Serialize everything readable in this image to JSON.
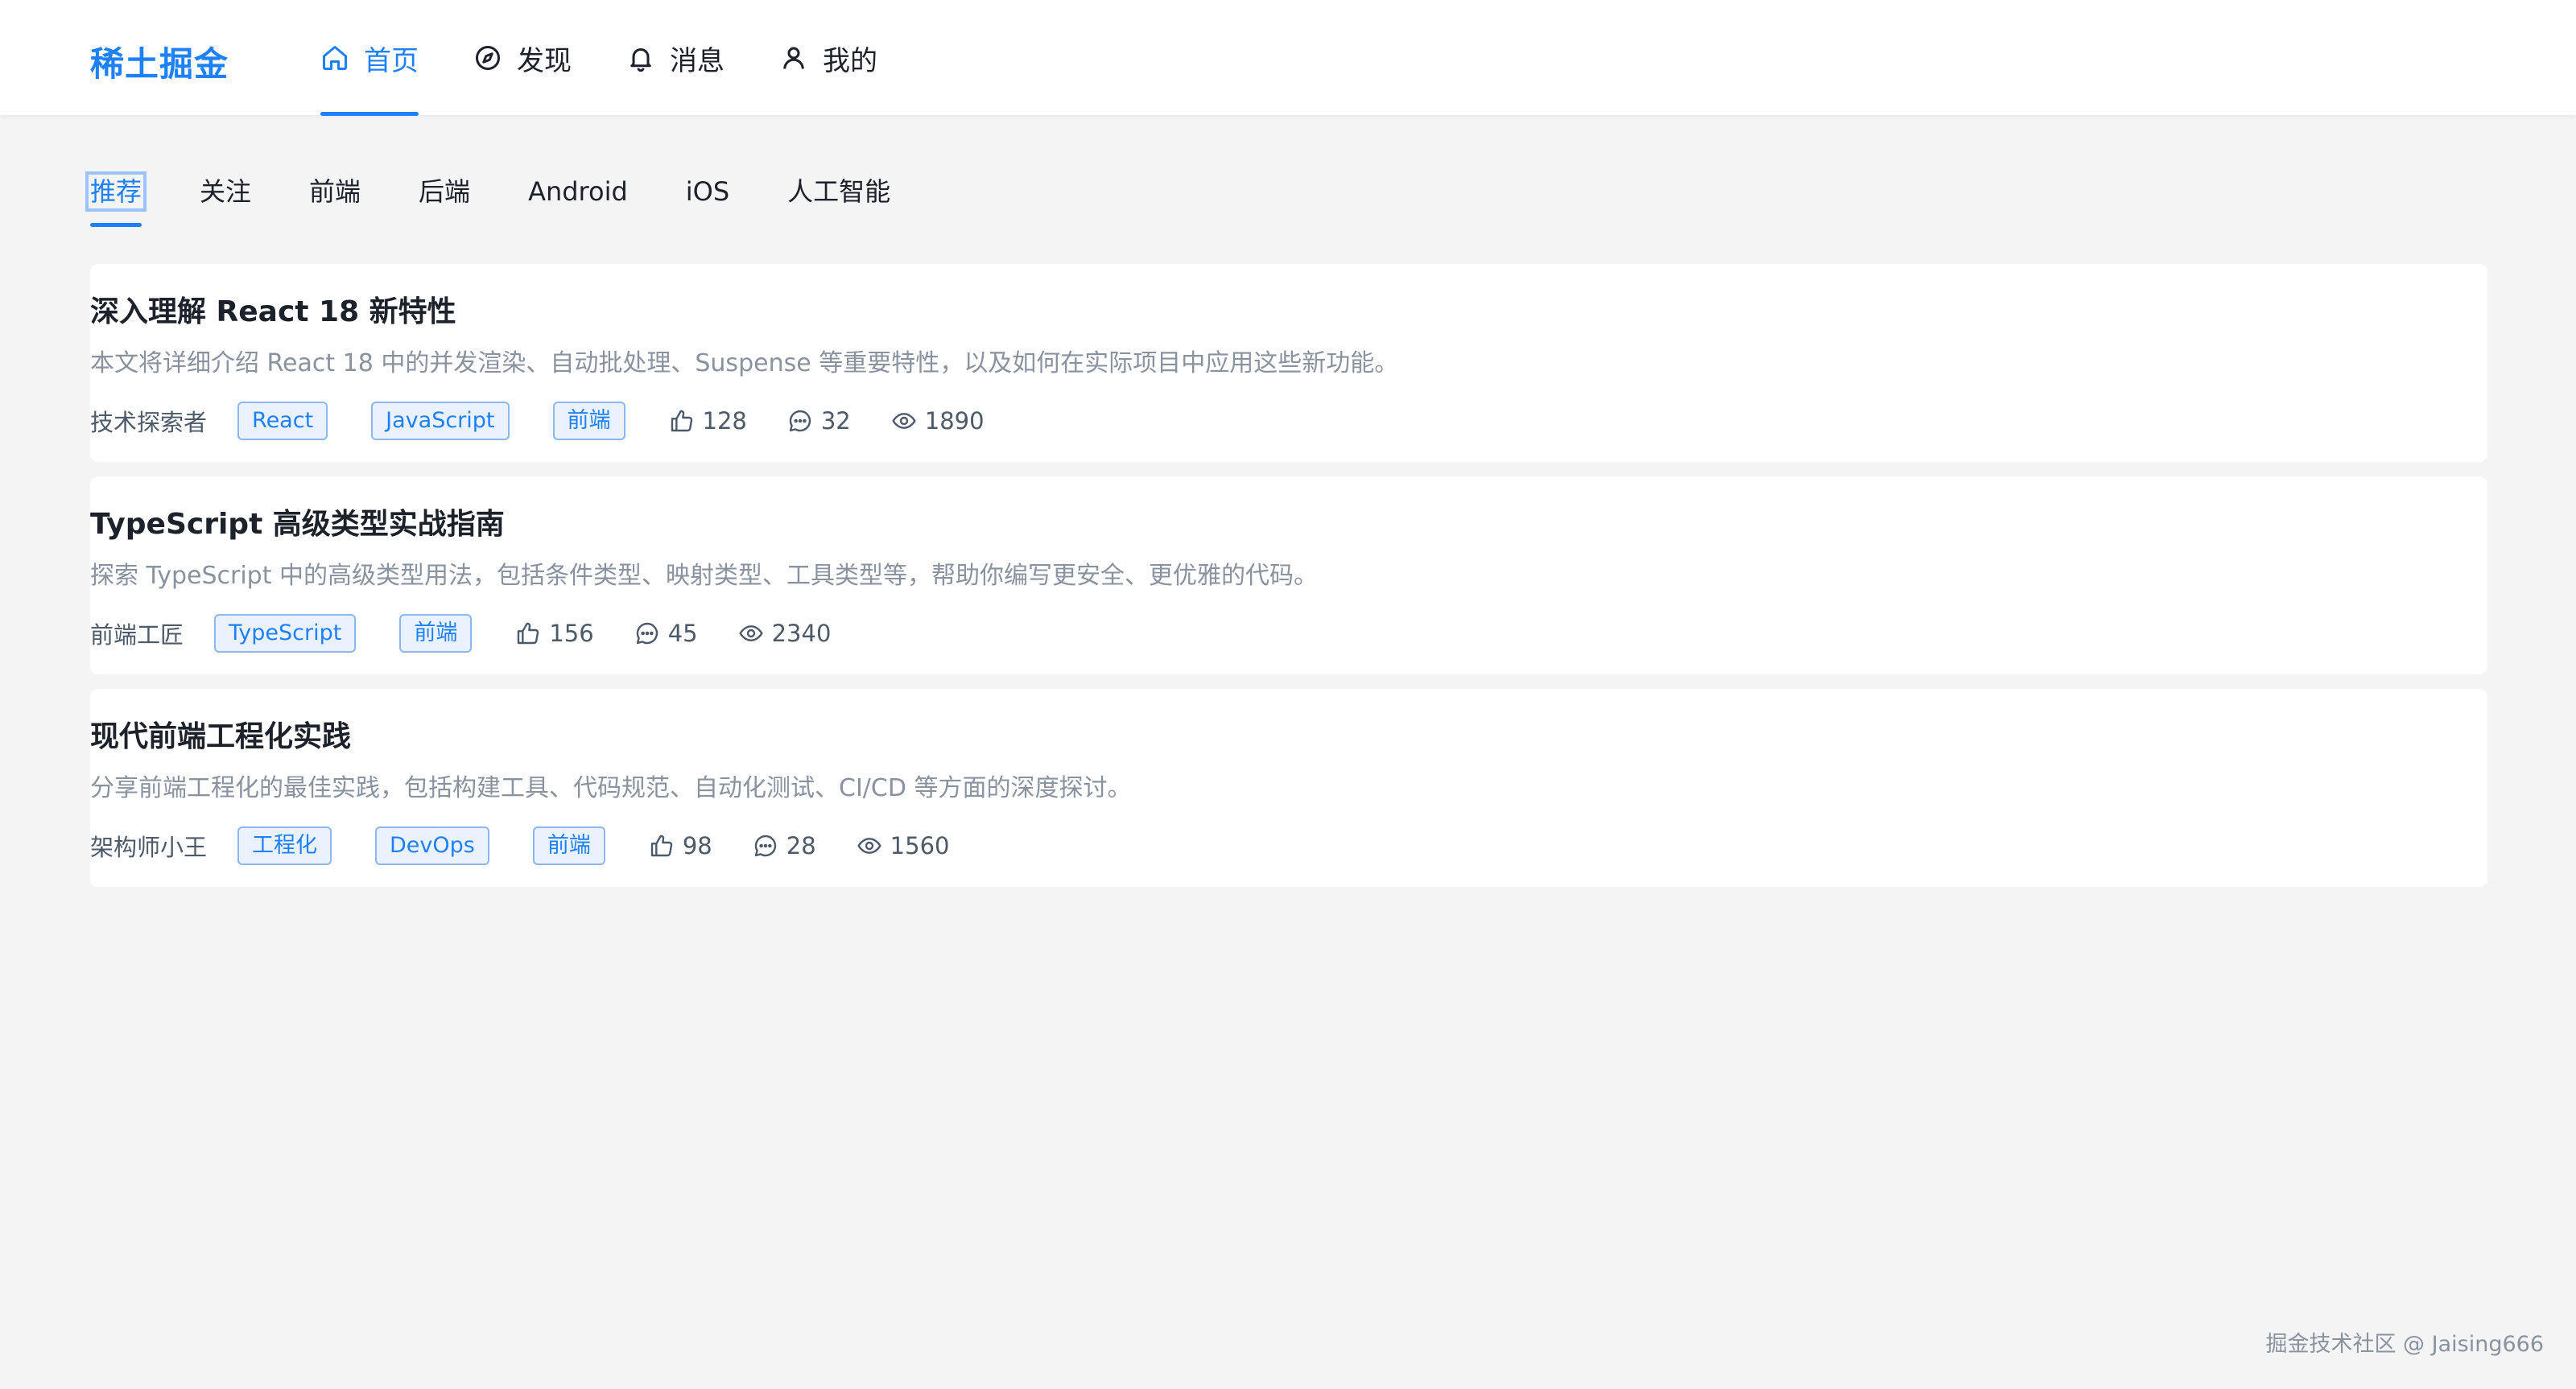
{
  "header": {
    "logo": "稀土掘金",
    "nav": [
      {
        "label": "首页",
        "icon": "home-icon",
        "active": true
      },
      {
        "label": "发现",
        "icon": "compass-icon",
        "active": false
      },
      {
        "label": "消息",
        "icon": "bell-icon",
        "active": false
      },
      {
        "label": "我的",
        "icon": "user-icon",
        "active": false
      }
    ]
  },
  "tabs": [
    {
      "label": "推荐",
      "active": true
    },
    {
      "label": "关注"
    },
    {
      "label": "前端"
    },
    {
      "label": "后端"
    },
    {
      "label": "Android"
    },
    {
      "label": "iOS"
    },
    {
      "label": "人工智能"
    }
  ],
  "articles": [
    {
      "title": "深入理解 React 18 新特性",
      "summary": "本文将详细介绍 React 18 中的并发渲染、自动批处理、Suspense 等重要特性，以及如何在实际项目中应用这些新功能。",
      "author": "技术探索者",
      "tags": [
        "React",
        "JavaScript",
        "前端"
      ],
      "likes": "128",
      "comments": "32",
      "views": "1890"
    },
    {
      "title": "TypeScript 高级类型实战指南",
      "summary": "探索 TypeScript 中的高级类型用法，包括条件类型、映射类型、工具类型等，帮助你编写更安全、更优雅的代码。",
      "author": "前端工匠",
      "tags": [
        "TypeScript",
        "前端"
      ],
      "likes": "156",
      "comments": "45",
      "views": "2340"
    },
    {
      "title": "现代前端工程化实践",
      "summary": "分享前端工程化的最佳实践，包括构建工具、代码规范、自动化测试、CI/CD 等方面的深度探讨。",
      "author": "架构师小王",
      "tags": [
        "工程化",
        "DevOps",
        "前端"
      ],
      "likes": "98",
      "comments": "28",
      "views": "1560"
    }
  ],
  "watermark": "掘金技术社区 @ Jaising666",
  "colors": {
    "accent": "#1e80ff",
    "background": "#f4f4f5",
    "muted": "#8a919f"
  }
}
